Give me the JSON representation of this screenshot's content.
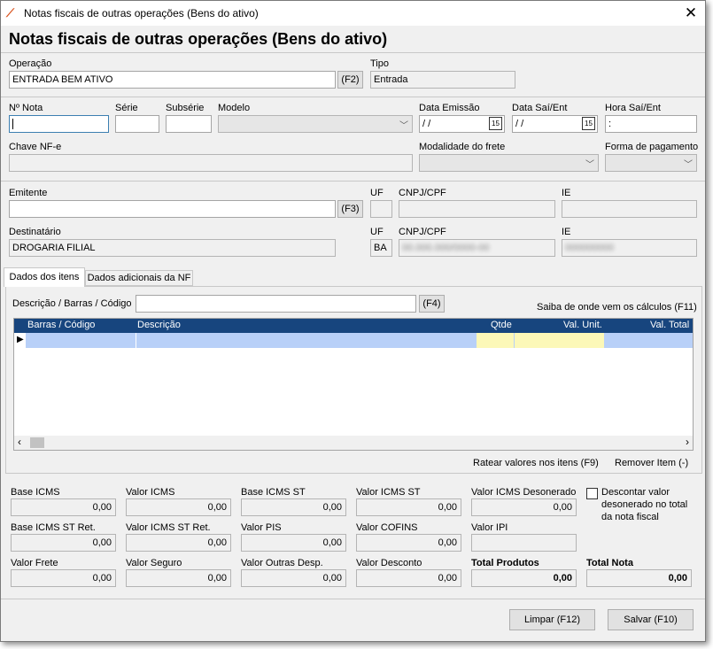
{
  "window": {
    "title": "Notas fiscais de outras operações (Bens do ativo)",
    "close": "✕"
  },
  "heading": "Notas fiscais de outras operações (Bens do ativo)",
  "operacao": {
    "label": "Operação",
    "value": "ENTRADA BEM ATIVO",
    "shortcut": "(F2)"
  },
  "tipo": {
    "label": "Tipo",
    "value": "Entrada"
  },
  "nota": {
    "numero_label": "Nº Nota",
    "serie_label": "Série",
    "subserie_label": "Subsérie",
    "modelo_label": "Modelo",
    "data_emissao_label": "Data Emissão",
    "data_emissao_value": " / /",
    "data_saient_label": "Data Saí/Ent",
    "data_saient_value": " / /",
    "hora_label": "Hora Saí/Ent",
    "hora_value": "  :",
    "calendar_glyph": "15",
    "chave_label": "Chave NF-e",
    "modalidade_label": "Modalidade do frete",
    "forma_label": "Forma de pagamento",
    "combo_arrow": "﹀"
  },
  "emitente": {
    "label": "Emitente",
    "shortcut": "(F3)",
    "uf_label": "UF",
    "cnpj_label": "CNPJ/CPF",
    "ie_label": "IE"
  },
  "destinatario": {
    "label": "Destinatário",
    "value": "DROGARIA FILIAL",
    "uf_label": "UF",
    "uf_value": "BA",
    "cnpj_label": "CNPJ/CPF",
    "cnpj_value": "00.000.000/0000-00",
    "ie_label": "IE",
    "ie_value": "000000000"
  },
  "tabs": [
    {
      "label": "Dados dos itens"
    },
    {
      "label": "Dados adicionais da NF"
    }
  ],
  "itens": {
    "search_label": "Descrição / Barras / Código",
    "search_shortcut": "(F4)",
    "calc_link": "Saiba de onde vem os cálculos (F11)",
    "columns": [
      "Barras / Código",
      "Descrição",
      "Qtde",
      "Val. Unit.",
      "Val. Total"
    ],
    "row_indicator": "▶",
    "scroll_left": "‹",
    "scroll_right": "›",
    "ratear": "Ratear valores nos itens (F9)",
    "remover": "Remover Item (-)"
  },
  "totais": {
    "base_icms": {
      "label": "Base ICMS",
      "value": "0,00"
    },
    "valor_icms": {
      "label": "Valor ICMS",
      "value": "0,00"
    },
    "base_icms_st": {
      "label": "Base ICMS ST",
      "value": "0,00"
    },
    "valor_icms_st": {
      "label": "Valor ICMS ST",
      "value": "0,00"
    },
    "valor_icms_deson": {
      "label": "Valor ICMS Desonerado",
      "value": "0,00"
    },
    "base_icms_st_ret": {
      "label": "Base ICMS ST Ret.",
      "value": "0,00"
    },
    "valor_icms_st_ret": {
      "label": "Valor ICMS ST Ret.",
      "value": "0,00"
    },
    "valor_pis": {
      "label": "Valor PIS",
      "value": "0,00"
    },
    "valor_cofins": {
      "label": "Valor COFINS",
      "value": "0,00"
    },
    "valor_ipi": {
      "label": "Valor IPI",
      "value": ""
    },
    "valor_frete": {
      "label": "Valor Frete",
      "value": "0,00"
    },
    "valor_seguro": {
      "label": "Valor Seguro",
      "value": "0,00"
    },
    "valor_outras": {
      "label": "Valor Outras Desp.",
      "value": "0,00"
    },
    "valor_desconto": {
      "label": "Valor Desconto",
      "value": "0,00"
    },
    "total_produtos": {
      "label": "Total Produtos",
      "value": "0,00"
    },
    "total_nota": {
      "label": "Total Nota",
      "value": "0,00"
    },
    "descontar_l1": "Descontar valor",
    "descontar_l2": "desonerado no total",
    "descontar_l3": "da nota fiscal"
  },
  "buttons": {
    "limpar": "Limpar (F12)",
    "salvar": "Salvar (F10)"
  },
  "colors": {
    "grid_header": "#17457e",
    "row_selected": "#b8d0f8",
    "row_yellow": "#fcf8b8",
    "app_icon": "#d9531e"
  }
}
